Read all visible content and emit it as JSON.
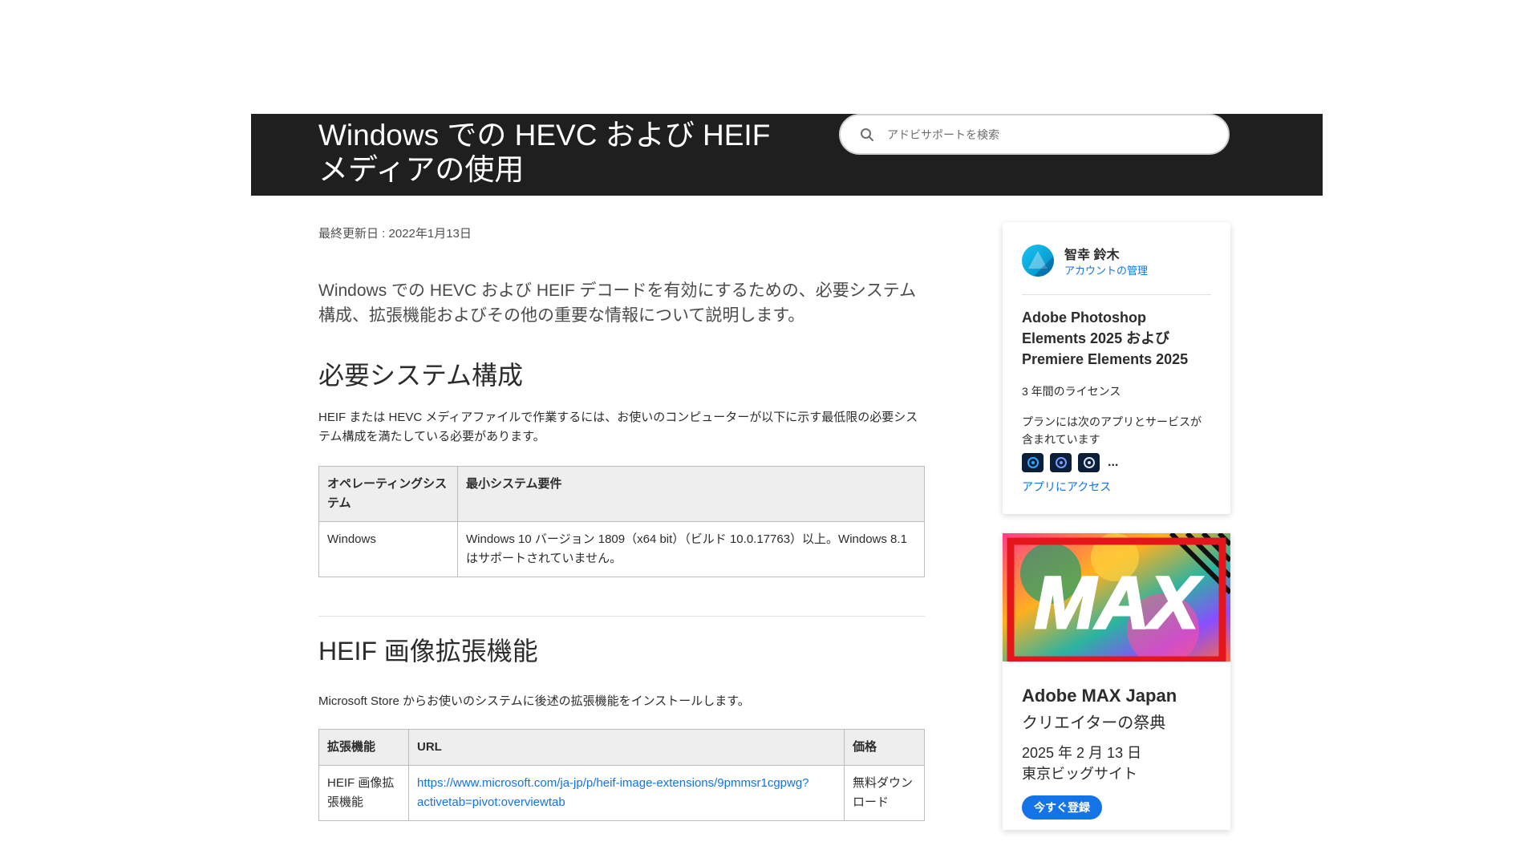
{
  "header": {
    "title": "Windows での HEVC および HEIF メディアの使用",
    "search_placeholder": "アドビサポートを検索"
  },
  "article": {
    "last_updated": "最終更新日 : 2022年1月13日",
    "intro": "Windows での HEVC および HEIF デコードを有効にするための、必要システム構成、拡張機能およびその他の重要な情報について説明します。",
    "section1": {
      "title": "必要システム構成",
      "paragraph": "HEIF または HEVC メディアファイルで作業するには、お使いのコンピューターが以下に示す最低限の必要システム構成を満たしている必要があります。",
      "table": {
        "headers": [
          "オペレーティングシステム",
          "最小システム要件"
        ],
        "rows": [
          [
            "Windows",
            "Windows 10 バージョン 1809（x64 bit）（ビルド 10.0.17763）以上。Windows 8.1 はサポートされていません。"
          ]
        ]
      }
    },
    "section2": {
      "title": "HEIF 画像拡張機能",
      "paragraph": "Microsoft Store からお使いのシステムに後述の拡張機能をインストールします。",
      "table": {
        "headers": [
          "拡張機能",
          "URL",
          "価格"
        ],
        "rows": [
          {
            "name": "HEIF 画像拡張機能",
            "url": "https://www.microsoft.com/ja-jp/p/heif-image-extensions/9pmmsr1cgpwg?activetab=pivot:overviewtab",
            "price": "無料ダウンロード"
          }
        ]
      }
    }
  },
  "account_card": {
    "user_name": "智幸 鈴木",
    "manage_link": "アカウントの管理",
    "plan_title": "Adobe Photoshop Elements 2025 および Premiere Elements 2025",
    "license": "3 年間のライセンス",
    "includes": "プランには次のアプリとサービスが含まれています",
    "more": "...",
    "apps_link": "アプリにアクセス",
    "app_icons": [
      "photoshop-elements-icon",
      "premiere-elements-icon",
      "elements-organizer-icon"
    ]
  },
  "promo_card": {
    "image_text": "MAX",
    "title": "Adobe MAX Japan",
    "subtitle": "クリエイターの祭典",
    "date": "2025 年 2 月 13 日",
    "venue": "東京ビッグサイト",
    "button_label": "今すぐ登録"
  },
  "colors": {
    "banner_bg": "#1f1f1f",
    "link": "#1473e6",
    "promo_red": "#e4161c"
  }
}
